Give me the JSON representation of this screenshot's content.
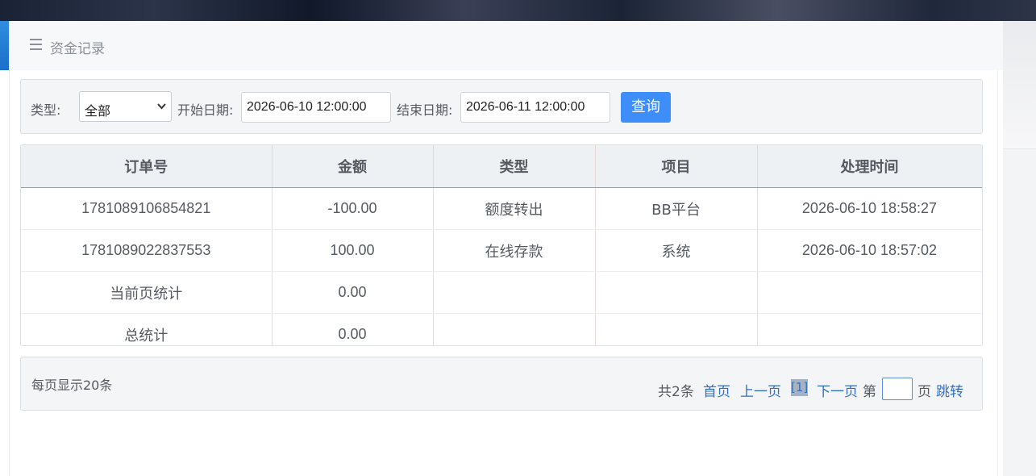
{
  "page": {
    "title": "资金记录"
  },
  "filter": {
    "type_label": "类型:",
    "type_value": "全部",
    "start_label": "开始日期:",
    "start_value": "2026-06-10 12:00:00",
    "end_label": "结束日期:",
    "end_value": "2026-06-11 12:00:00",
    "query_button": "查询"
  },
  "table": {
    "headers": [
      "订单号",
      "金额",
      "类型",
      "项目",
      "处理时间"
    ],
    "rows": [
      [
        "1781089106854821",
        "-100.00",
        "额度转出",
        "BB平台",
        "2026-06-10 18:58:27"
      ],
      [
        "1781089022837553",
        "100.00",
        "在线存款",
        "系统",
        "2026-06-10 18:57:02"
      ],
      [
        "当前页统计",
        "0.00",
        "",
        "",
        ""
      ],
      [
        "总统计",
        "0.00",
        "",
        "",
        ""
      ]
    ]
  },
  "pager": {
    "per_page": "每页显示20条",
    "total": "共2条",
    "first": "首页",
    "prev": "上一页",
    "current": "[1]",
    "next": "下一页",
    "page_prefix": "第",
    "page_suffix": "页",
    "jump": "跳转"
  },
  "icons": {
    "menu": "hamburger-icon",
    "dropdown": "chevron-down-icon"
  },
  "colors": {
    "accent": "#3d8ef8",
    "link": "#2f6fc6"
  }
}
